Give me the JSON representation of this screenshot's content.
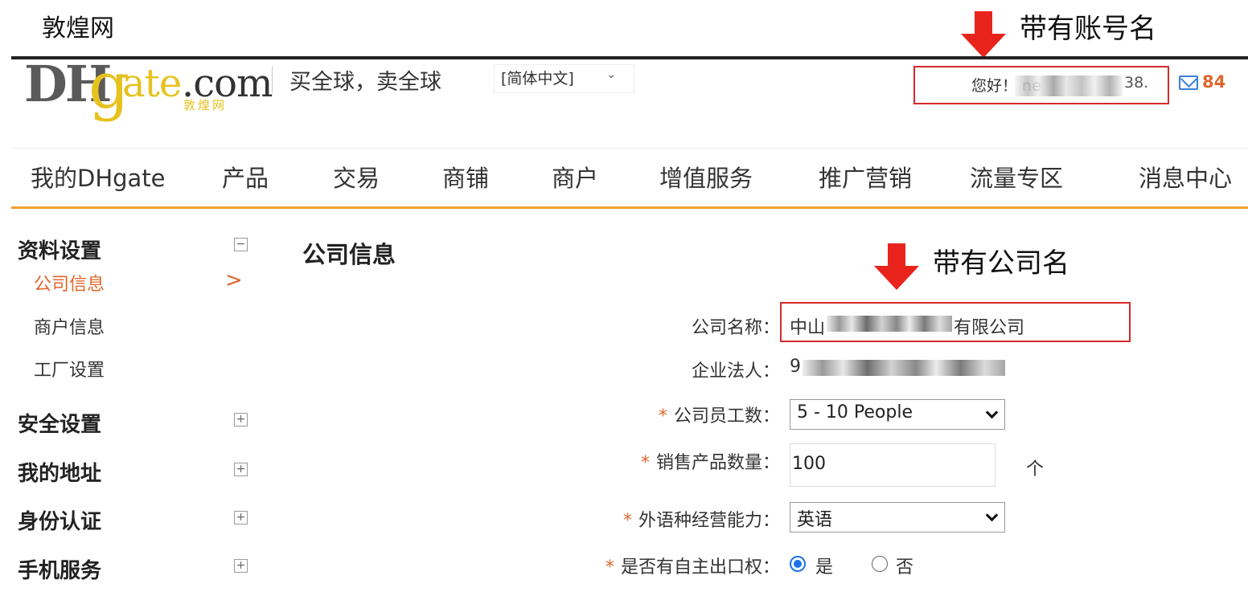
{
  "caption": "敦煌网",
  "annotations": {
    "account_note": "带有账号名",
    "company_note": "带有公司名",
    "highlight_color": "#d42a2a",
    "arrow_color": "#e8231c"
  },
  "header": {
    "logo": {
      "dh": "DH",
      "g": "g",
      "ate": "ate",
      "com": ".com",
      "sub": "敦煌网"
    },
    "slogan": "买全球，卖全球",
    "language": "[简体中文]",
    "greeting": "您好！ ne",
    "username_suffix": "38.",
    "message_count": "84",
    "accent_color": "#f5a033"
  },
  "nav": {
    "items": [
      {
        "label": "我的DHgate"
      },
      {
        "label": "产品"
      },
      {
        "label": "交易"
      },
      {
        "label": "商铺"
      },
      {
        "label": "商户"
      },
      {
        "label": "增值服务"
      },
      {
        "label": "推广营销"
      },
      {
        "label": "流量专区"
      },
      {
        "label": "消息中心"
      }
    ]
  },
  "sidebar": {
    "groups": [
      {
        "label": "资料设置",
        "toggle": "−",
        "items": [
          {
            "label": "公司信息",
            "active": true
          },
          {
            "label": "商户信息"
          },
          {
            "label": "工厂设置"
          }
        ]
      },
      {
        "label": "安全设置",
        "toggle": "+"
      },
      {
        "label": "我的地址",
        "toggle": "+"
      },
      {
        "label": "身份认证",
        "toggle": "+"
      },
      {
        "label": "手机服务",
        "toggle": "+"
      }
    ],
    "active_marker": ">"
  },
  "form": {
    "title": "公司信息",
    "company_name": {
      "label": "公司名称：",
      "value_prefix": "中山",
      "value_suffix": "有限公司"
    },
    "legal_person": {
      "label": "企业法人：",
      "value_prefix": "9"
    },
    "employees": {
      "required": "*",
      "label": "公司员工数：",
      "value": "5 - 10 People"
    },
    "product_count": {
      "required": "*",
      "label": "销售产品数量：",
      "value": "100",
      "unit": "个"
    },
    "languages": {
      "required": "*",
      "label": "外语种经营能力：",
      "value": "英语"
    },
    "export_right": {
      "required": "*",
      "label": "是否有自主出口权：",
      "options": [
        "是",
        "否"
      ],
      "selected": "是"
    }
  }
}
